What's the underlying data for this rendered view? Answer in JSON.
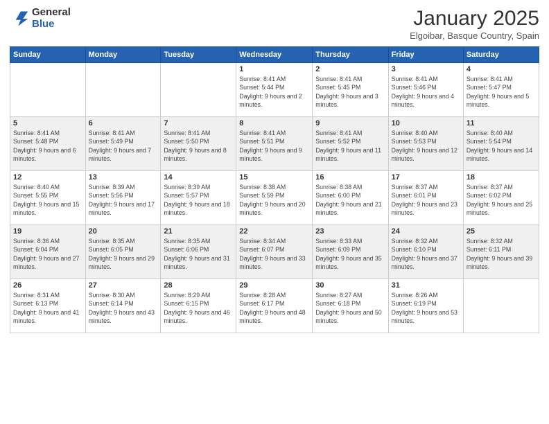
{
  "brand": {
    "line1": "General",
    "line2": "Blue"
  },
  "title": "January 2025",
  "subtitle": "Elgoibar, Basque Country, Spain",
  "weekdays": [
    "Sunday",
    "Monday",
    "Tuesday",
    "Wednesday",
    "Thursday",
    "Friday",
    "Saturday"
  ],
  "weeks": [
    [
      {
        "day": "",
        "info": ""
      },
      {
        "day": "",
        "info": ""
      },
      {
        "day": "",
        "info": ""
      },
      {
        "day": "1",
        "info": "Sunrise: 8:41 AM\nSunset: 5:44 PM\nDaylight: 9 hours and 2 minutes."
      },
      {
        "day": "2",
        "info": "Sunrise: 8:41 AM\nSunset: 5:45 PM\nDaylight: 9 hours and 3 minutes."
      },
      {
        "day": "3",
        "info": "Sunrise: 8:41 AM\nSunset: 5:46 PM\nDaylight: 9 hours and 4 minutes."
      },
      {
        "day": "4",
        "info": "Sunrise: 8:41 AM\nSunset: 5:47 PM\nDaylight: 9 hours and 5 minutes."
      }
    ],
    [
      {
        "day": "5",
        "info": "Sunrise: 8:41 AM\nSunset: 5:48 PM\nDaylight: 9 hours and 6 minutes."
      },
      {
        "day": "6",
        "info": "Sunrise: 8:41 AM\nSunset: 5:49 PM\nDaylight: 9 hours and 7 minutes."
      },
      {
        "day": "7",
        "info": "Sunrise: 8:41 AM\nSunset: 5:50 PM\nDaylight: 9 hours and 8 minutes."
      },
      {
        "day": "8",
        "info": "Sunrise: 8:41 AM\nSunset: 5:51 PM\nDaylight: 9 hours and 9 minutes."
      },
      {
        "day": "9",
        "info": "Sunrise: 8:41 AM\nSunset: 5:52 PM\nDaylight: 9 hours and 11 minutes."
      },
      {
        "day": "10",
        "info": "Sunrise: 8:40 AM\nSunset: 5:53 PM\nDaylight: 9 hours and 12 minutes."
      },
      {
        "day": "11",
        "info": "Sunrise: 8:40 AM\nSunset: 5:54 PM\nDaylight: 9 hours and 14 minutes."
      }
    ],
    [
      {
        "day": "12",
        "info": "Sunrise: 8:40 AM\nSunset: 5:55 PM\nDaylight: 9 hours and 15 minutes."
      },
      {
        "day": "13",
        "info": "Sunrise: 8:39 AM\nSunset: 5:56 PM\nDaylight: 9 hours and 17 minutes."
      },
      {
        "day": "14",
        "info": "Sunrise: 8:39 AM\nSunset: 5:57 PM\nDaylight: 9 hours and 18 minutes."
      },
      {
        "day": "15",
        "info": "Sunrise: 8:38 AM\nSunset: 5:59 PM\nDaylight: 9 hours and 20 minutes."
      },
      {
        "day": "16",
        "info": "Sunrise: 8:38 AM\nSunset: 6:00 PM\nDaylight: 9 hours and 21 minutes."
      },
      {
        "day": "17",
        "info": "Sunrise: 8:37 AM\nSunset: 6:01 PM\nDaylight: 9 hours and 23 minutes."
      },
      {
        "day": "18",
        "info": "Sunrise: 8:37 AM\nSunset: 6:02 PM\nDaylight: 9 hours and 25 minutes."
      }
    ],
    [
      {
        "day": "19",
        "info": "Sunrise: 8:36 AM\nSunset: 6:04 PM\nDaylight: 9 hours and 27 minutes."
      },
      {
        "day": "20",
        "info": "Sunrise: 8:35 AM\nSunset: 6:05 PM\nDaylight: 9 hours and 29 minutes."
      },
      {
        "day": "21",
        "info": "Sunrise: 8:35 AM\nSunset: 6:06 PM\nDaylight: 9 hours and 31 minutes."
      },
      {
        "day": "22",
        "info": "Sunrise: 8:34 AM\nSunset: 6:07 PM\nDaylight: 9 hours and 33 minutes."
      },
      {
        "day": "23",
        "info": "Sunrise: 8:33 AM\nSunset: 6:09 PM\nDaylight: 9 hours and 35 minutes."
      },
      {
        "day": "24",
        "info": "Sunrise: 8:32 AM\nSunset: 6:10 PM\nDaylight: 9 hours and 37 minutes."
      },
      {
        "day": "25",
        "info": "Sunrise: 8:32 AM\nSunset: 6:11 PM\nDaylight: 9 hours and 39 minutes."
      }
    ],
    [
      {
        "day": "26",
        "info": "Sunrise: 8:31 AM\nSunset: 6:13 PM\nDaylight: 9 hours and 41 minutes."
      },
      {
        "day": "27",
        "info": "Sunrise: 8:30 AM\nSunset: 6:14 PM\nDaylight: 9 hours and 43 minutes."
      },
      {
        "day": "28",
        "info": "Sunrise: 8:29 AM\nSunset: 6:15 PM\nDaylight: 9 hours and 46 minutes."
      },
      {
        "day": "29",
        "info": "Sunrise: 8:28 AM\nSunset: 6:17 PM\nDaylight: 9 hours and 48 minutes."
      },
      {
        "day": "30",
        "info": "Sunrise: 8:27 AM\nSunset: 6:18 PM\nDaylight: 9 hours and 50 minutes."
      },
      {
        "day": "31",
        "info": "Sunrise: 8:26 AM\nSunset: 6:19 PM\nDaylight: 9 hours and 53 minutes."
      },
      {
        "day": "",
        "info": ""
      }
    ]
  ]
}
